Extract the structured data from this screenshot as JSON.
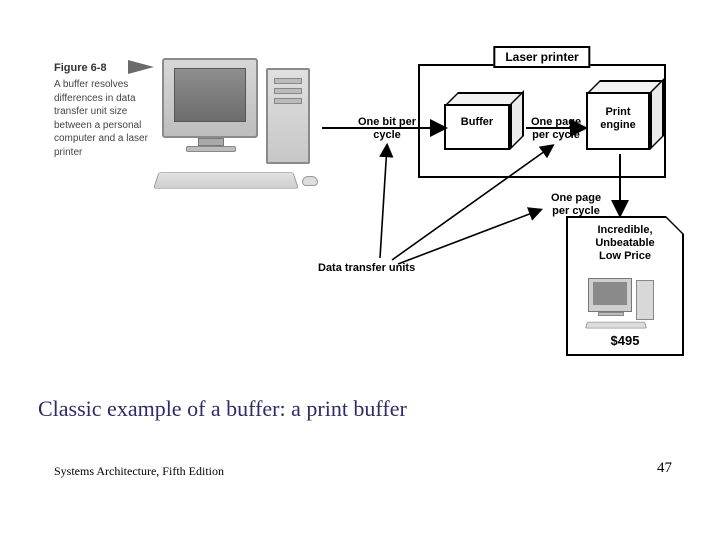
{
  "figure": {
    "number": "Figure 6-8",
    "caption": "A buffer resolves differences in data transfer unit size between a personal computer and a laser printer"
  },
  "diagram": {
    "printer_group_label": "Laser printer",
    "buffer_label": "Buffer",
    "print_engine_label": "Print\nengine",
    "arrow_labels": {
      "pc_to_buffer": "One bit per\ncycle",
      "buffer_to_engine": "One page\nper cycle",
      "engine_to_flyer": "One page\nper cycle"
    },
    "data_transfer_units_label": "Data transfer units"
  },
  "flyer": {
    "headline": "Incredible,\nUnbeatable\nLow Price",
    "price": "$495"
  },
  "slide": {
    "caption": "Classic example of a buffer: a print buffer",
    "footer_left": "Systems Architecture, Fifth Edition",
    "page_number": "47"
  }
}
